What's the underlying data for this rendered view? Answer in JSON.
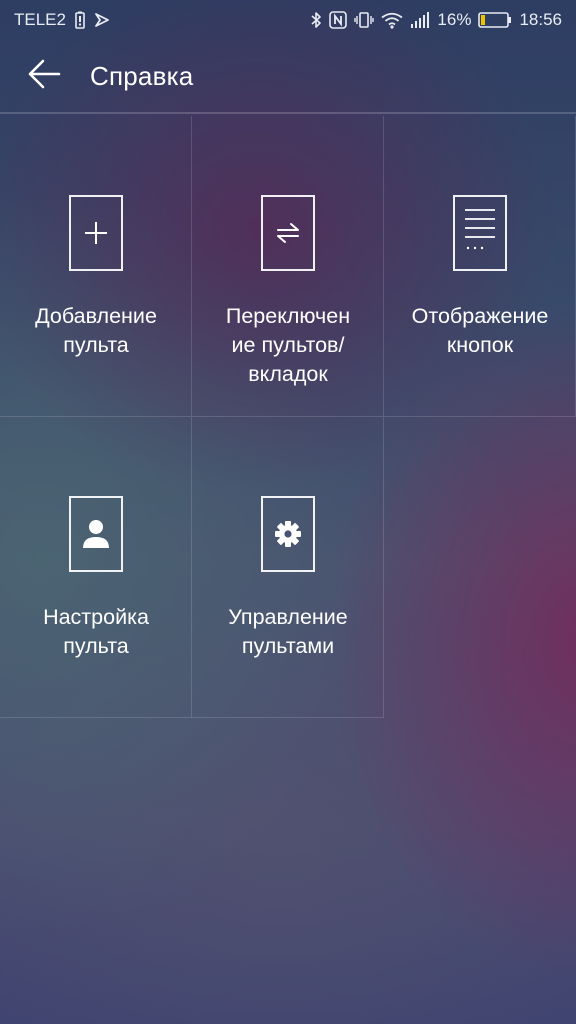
{
  "status_bar": {
    "carrier": "TELE2",
    "battery_percent": "16%",
    "time": "18:56",
    "icons": [
      "battery-saver-icon",
      "app-notification-icon",
      "bluetooth-icon",
      "nfc-icon",
      "vibrate-icon",
      "wifi-icon",
      "signal-icon",
      "battery-icon"
    ]
  },
  "header": {
    "back_icon": "arrow-left-icon",
    "title": "Справка"
  },
  "tiles": [
    {
      "label": "Добавление\nпульта",
      "icon": "add-remote-icon"
    },
    {
      "label": "Переключен\nие пультов/\nвкладок",
      "icon": "switch-remote-icon"
    },
    {
      "label": "Отображение\nкнопок",
      "icon": "button-list-icon"
    },
    {
      "label": "Настройка\nпульта",
      "icon": "person-remote-icon"
    },
    {
      "label": "Управление\nпультами",
      "icon": "settings-remote-icon"
    }
  ],
  "colors": {
    "battery_level": "#f2c200",
    "text": "#ffffff"
  }
}
